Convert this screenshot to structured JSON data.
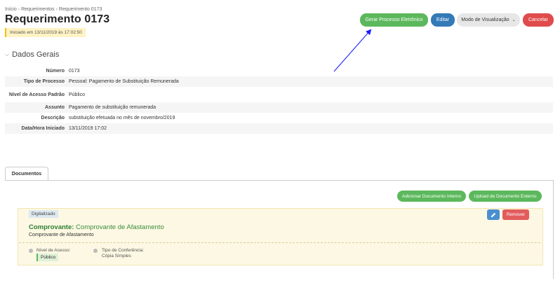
{
  "breadcrumb": [
    "Início",
    "Requerimentos",
    "Requerimento 0173"
  ],
  "header": {
    "title": "Requerimento 0173",
    "started": "Iniciado em 13/11/2019 às 17:02:50"
  },
  "actions": {
    "generate": "Gerar Processo Eletrônico",
    "edit": "Editar",
    "view_mode": "Modo de Visualização",
    "cancel": "Cancelar"
  },
  "section": {
    "title": "Dados Gerais"
  },
  "details": [
    {
      "label": "Número",
      "value": "0173"
    },
    {
      "label": "Tipo de Processo",
      "value": "Pessoal: Pagamento de Substituição Remunerada"
    },
    {
      "label": "Nível de Acesso Padrão",
      "value": "Público"
    },
    {
      "label": "Assunto",
      "value": "Pagamento de substituição remunerada"
    },
    {
      "label": "Descrição",
      "value": "substituição efetuada no mês de novembro/2019"
    },
    {
      "label": "Data/Hora Iniciado",
      "value": "13/11/2019 17:02"
    }
  ],
  "documents": {
    "tab": "Documentos",
    "add_internal": "Adicionar Documento Interno",
    "upload_external": "Upload de Documento Externo",
    "card": {
      "tag": "Digitalizado",
      "type_label": "Comprovante:",
      "type_value": "Comprovante de Afastamento",
      "subtitle": "Comprovante de Afastamento",
      "access_label": "Nível de Acesso:",
      "access_value": "Público",
      "conference_label": "Tipo de Conferência:",
      "conference_value": "Cópia Simples",
      "remove": "Remover"
    }
  },
  "colors": {
    "green": "#5cb85c",
    "blue": "#337ab7",
    "red": "#e04b4b",
    "arrow": "#1a1aff"
  }
}
